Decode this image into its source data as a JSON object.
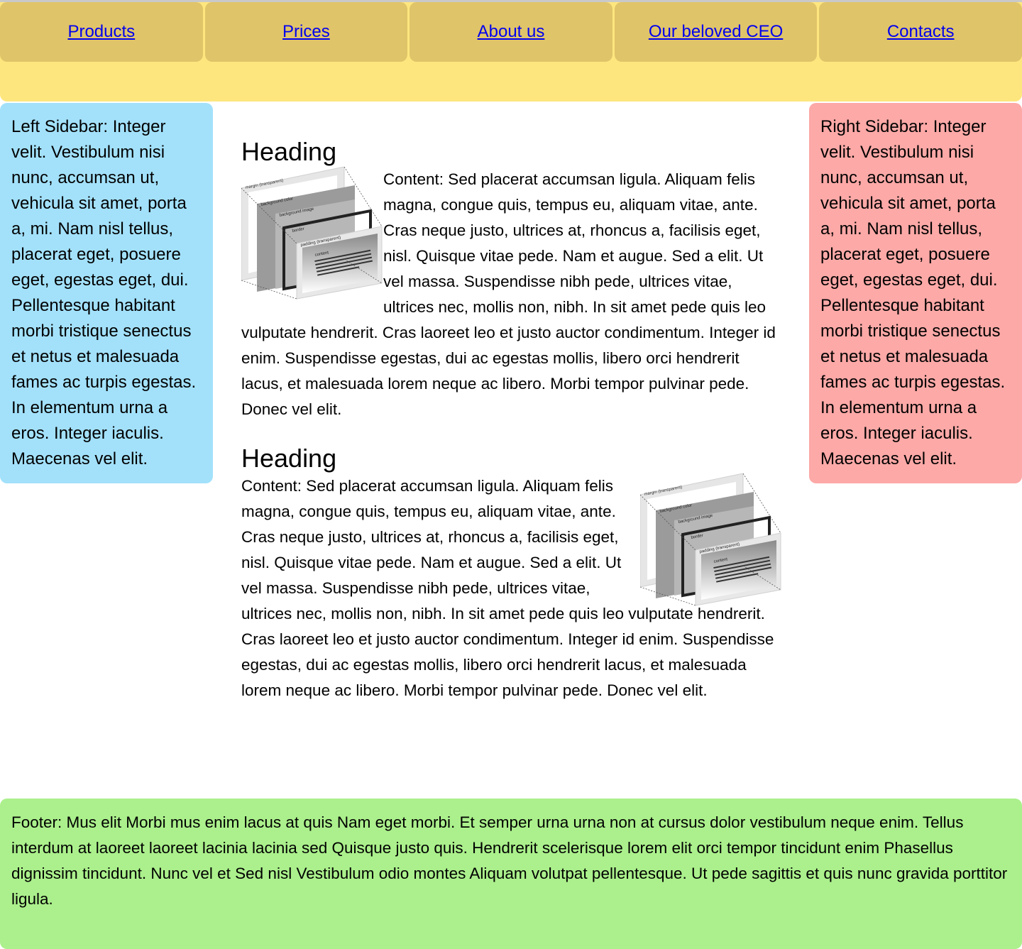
{
  "nav": {
    "items": [
      "Products",
      "Prices",
      "About us",
      "Our beloved CEO",
      "Contacts"
    ]
  },
  "left_sidebar": {
    "text": "Left Sidebar: Integer velit. Vestibulum nisi nunc, accumsan ut, vehicula sit amet, porta a, mi. Nam nisl tellus, placerat eget, posuere eget, egestas eget, dui. Pellentesque habitant morbi tristique senectus et netus et malesuada fames ac turpis egestas. In elementum urna a eros. Integer iaculis. Maecenas vel elit."
  },
  "right_sidebar": {
    "text": "Right Sidebar: Integer velit. Vestibulum nisi nunc, accumsan ut, vehicula sit amet, porta a, mi. Nam nisl tellus, placerat eget, posuere eget, egestas eget, dui. Pellentesque habitant morbi tristique senectus et netus et malesuada fames ac turpis egestas. In elementum urna a eros. Integer iaculis. Maecenas vel elit."
  },
  "articles": [
    {
      "heading": "Heading",
      "content": "Content: Sed placerat accumsan ligula. Aliquam felis magna, congue quis, tempus eu, aliquam vitae, ante. Cras neque justo, ultrices at, rhoncus a, facilisis eget, nisl. Quisque vitae pede. Nam et augue. Sed a elit. Ut vel massa. Suspendisse nibh pede, ultrices vitae, ultrices nec, mollis non, nibh. In sit amet pede quis leo vulputate hendrerit. Cras laoreet leo et justo auctor condimentum. Integer id enim. Suspendisse egestas, dui ac egestas mollis, libero orci hendrerit lacus, et malesuada lorem neque ac libero. Morbi tempor pulvinar pede. Donec vel elit."
    },
    {
      "heading": "Heading",
      "content": "Content: Sed placerat accumsan ligula. Aliquam felis magna, congue quis, tempus eu, aliquam vitae, ante. Cras neque justo, ultrices at, rhoncus a, facilisis eget, nisl. Quisque vitae pede. Nam et augue. Sed a elit. Ut vel massa. Suspendisse nibh pede, ultrices vitae, ultrices nec, mollis non, nibh. In sit amet pede quis leo vulputate hendrerit. Cras laoreet leo et justo auctor condimentum. Integer id enim. Suspendisse egestas, dui ac egestas mollis, libero orci hendrerit lacus, et malesuada lorem neque ac libero. Morbi tempor pulvinar pede. Donec vel elit."
    }
  ],
  "diagram": {
    "labels": [
      "margin (transparent)",
      "background color",
      "background image",
      "border",
      "padding (transparent)",
      "content"
    ],
    "sample_text": "Lorem ipsum dolor sit amet, consectetuer adipiscing elit, sed diam nonummy nibh euismod tincidunt ut laoreet dolore magna aliquam erat volutpat. Ut wisi enim ad minim veniam, quis nostrud exerci tation ullamcorper suscipit lobortis nisl ut aliquip ex ea commodo consequat."
  },
  "footer": {
    "text": "Footer: Mus elit Morbi mus enim lacus at quis Nam eget morbi. Et semper urna urna non at cursus dolor vestibulum neque enim. Tellus interdum at laoreet laoreet lacinia lacinia sed Quisque justo quis. Hendrerit scelerisque lorem elit orci tempor tincidunt enim Phasellus dignissim tincidunt. Nunc vel et Sed nisl Vestibulum odio montes Aliquam volutpat pellentesque. Ut pede sagittis et quis nunc gravida porttitor ligula."
  },
  "colors": {
    "header": "#fee67e",
    "nav_item": "#e0c469",
    "left_sidebar": "#a3e1fb",
    "right_sidebar": "#fca9a7",
    "footer": "#abf08c",
    "link": "#0000ee"
  }
}
